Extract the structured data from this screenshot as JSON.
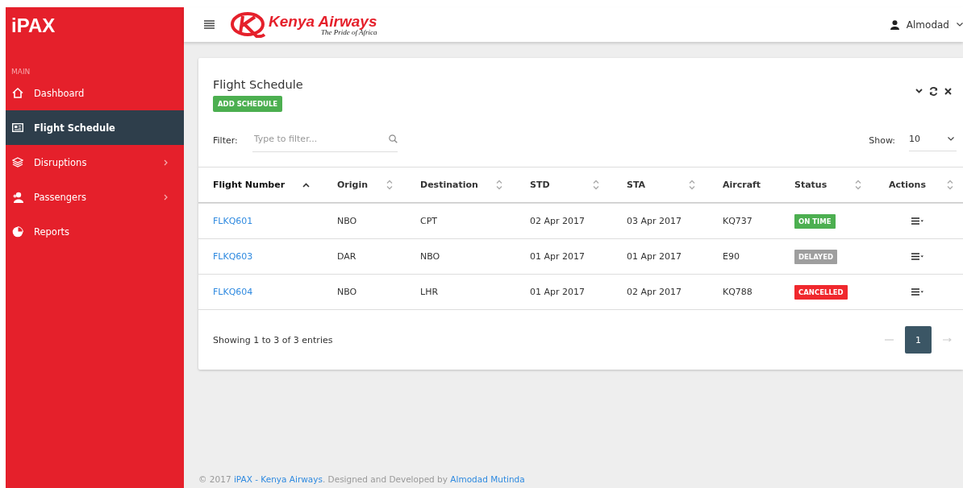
{
  "sidebar": {
    "brand": "iPAX",
    "section": "MAIN",
    "items": [
      {
        "label": "Dashboard",
        "selected": false,
        "expandable": false
      },
      {
        "label": "Flight Schedule",
        "selected": true,
        "expandable": false
      },
      {
        "label": "Disruptions",
        "selected": false,
        "expandable": true
      },
      {
        "label": "Passengers",
        "selected": false,
        "expandable": true
      },
      {
        "label": "Reports",
        "selected": false,
        "expandable": false
      }
    ]
  },
  "header": {
    "logo_name": "Kenya Airways",
    "logo_tagline": "The Pride of Africa",
    "user": "Almodad"
  },
  "card": {
    "title": "Flight Schedule",
    "add_button": "ADD SCHEDULE",
    "filter_label": "Filter:",
    "filter_placeholder": "Type to filter...",
    "show_label": "Show:",
    "show_value": "10"
  },
  "table": {
    "columns": [
      {
        "label": "Flight Number",
        "sortable": true,
        "sorted": true
      },
      {
        "label": "Origin",
        "sortable": true,
        "sorted": false
      },
      {
        "label": "Destination",
        "sortable": true,
        "sorted": false
      },
      {
        "label": "STD",
        "sortable": true,
        "sorted": false
      },
      {
        "label": "STA",
        "sortable": true,
        "sorted": false
      },
      {
        "label": "Aircraft",
        "sortable": false,
        "sorted": false
      },
      {
        "label": "Status",
        "sortable": true,
        "sorted": false
      },
      {
        "label": "Actions",
        "sortable": true,
        "sorted": false
      }
    ],
    "rows": [
      {
        "flight": "FLKQ601",
        "origin": "NBO",
        "destination": "CPT",
        "std": "02 Apr 2017",
        "sta": "03 Apr 2017",
        "aircraft": "KQ737",
        "status": {
          "label": "ON TIME",
          "kind": "ontime"
        }
      },
      {
        "flight": "FLKQ603",
        "origin": "DAR",
        "destination": "NBO",
        "std": "01 Apr 2017",
        "sta": "01 Apr 2017",
        "aircraft": "E90",
        "status": {
          "label": "DELAYED",
          "kind": "delayed"
        }
      },
      {
        "flight": "FLKQ604",
        "origin": "NBO",
        "destination": "LHR",
        "std": "01 Apr 2017",
        "sta": "02 Apr 2017",
        "aircraft": "KQ788",
        "status": {
          "label": "CANCELLED",
          "kind": "cancelled"
        }
      }
    ]
  },
  "pagination": {
    "info": "Showing 1 to 3 of 3 entries",
    "pages": [
      {
        "label": "1",
        "selected": true
      }
    ]
  },
  "footer": {
    "prefix": "© 2017 ",
    "link1": "iPAX - Kenya Airways",
    "middle": ". Designed and Developed by ",
    "link2": "Almodad Mutinda"
  }
}
